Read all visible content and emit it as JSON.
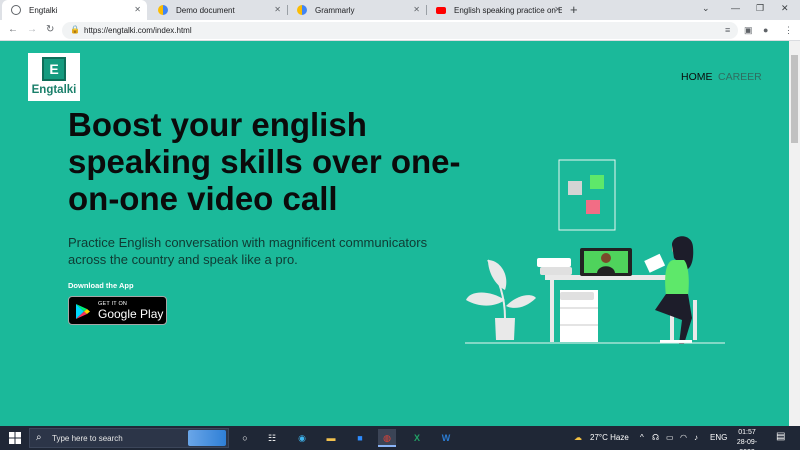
{
  "browser": {
    "tabs": [
      {
        "title": "Engtalki",
        "active": true
      },
      {
        "title": "Demo document",
        "active": false
      },
      {
        "title": "Grammarly",
        "active": false
      },
      {
        "title": "English speaking practice on Eng",
        "active": false
      }
    ],
    "new_tab_glyph": "+",
    "url": "https://engtalki.com/index.html"
  },
  "site": {
    "logo_letter": "E",
    "logo_name": "Engtalki",
    "nav": [
      {
        "label": "HOME",
        "color": "#0b0b0b"
      },
      {
        "label": "CAREER",
        "color": "#2f6d60"
      }
    ],
    "hero_title": "Boost your english speaking skills over one-on-one video call",
    "hero_subtitle": "Practice English conversation with magnificent communicators across the country and speak like a pro.",
    "download_label": "Download the App",
    "store_badge": {
      "small_text": "GET IT ON",
      "store_name": "Google Play"
    }
  },
  "taskbar": {
    "search_placeholder": "Type here to search",
    "weather": "27°C  Haze",
    "language": "ENG",
    "time": "01:57",
    "date": "28-09-2022"
  },
  "colors": {
    "page_bg": "#1bb99a",
    "taskbar_bg": "#1f2736",
    "accent_green": "#5ee86a",
    "accent_pink": "#f26d85"
  }
}
